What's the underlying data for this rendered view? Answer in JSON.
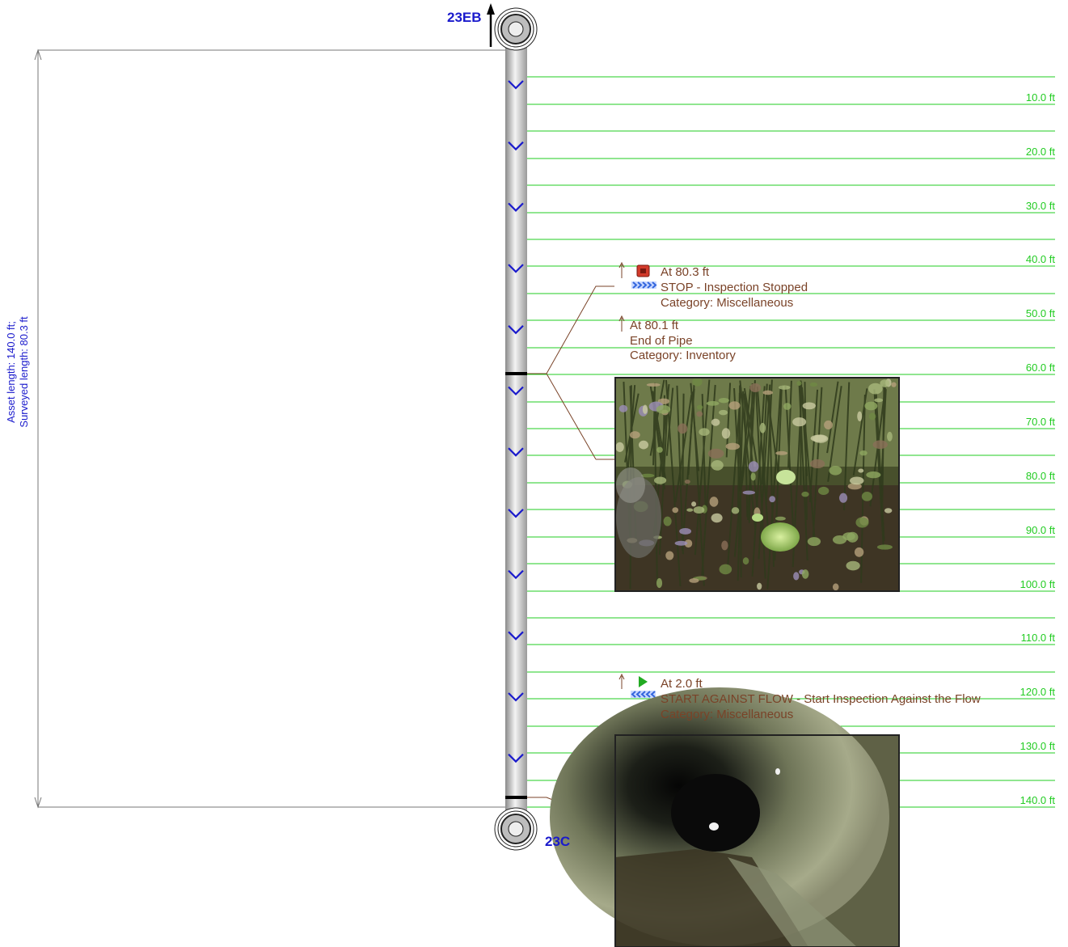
{
  "asset": {
    "upstream_node": "23EB",
    "downstream_node": "23C",
    "length_label_line1": "Asset length: 140.0 ft;",
    "length_label_line2": "Surveyed length: 80.3 ft"
  },
  "scale": {
    "distance_labels": [
      "10.0 ft",
      "20.0 ft",
      "30.0 ft",
      "40.0 ft",
      "50.0 ft",
      "60.0 ft",
      "70.0 ft",
      "80.0 ft",
      "90.0 ft",
      "100.0 ft",
      "110.0 ft",
      "120.0 ft",
      "130.0 ft",
      "140.0 ft"
    ]
  },
  "observations": [
    {
      "at": "At 80.3 ft",
      "code": "STOP - Inspection Stopped",
      "category": "Category: Miscellaneous",
      "icon": "stop-square-icon",
      "direction_icon": "downstream-chevron-icon"
    },
    {
      "at": "At 80.1 ft",
      "code": "End of Pipe",
      "category": "Category: Inventory"
    },
    {
      "at": "At 2.0 ft",
      "code": "START AGAINST FLOW - Start Inspection Against the Flow",
      "category": "Category: Miscellaneous",
      "icon": "play-triangle-icon",
      "direction_icon": "upstream-chevron-icon"
    }
  ],
  "colors": {
    "node_label": "#1a1acc",
    "scale_line": "#22cc22",
    "observation_text": "#7a4328",
    "flow_arrow": "#1a1acc"
  }
}
